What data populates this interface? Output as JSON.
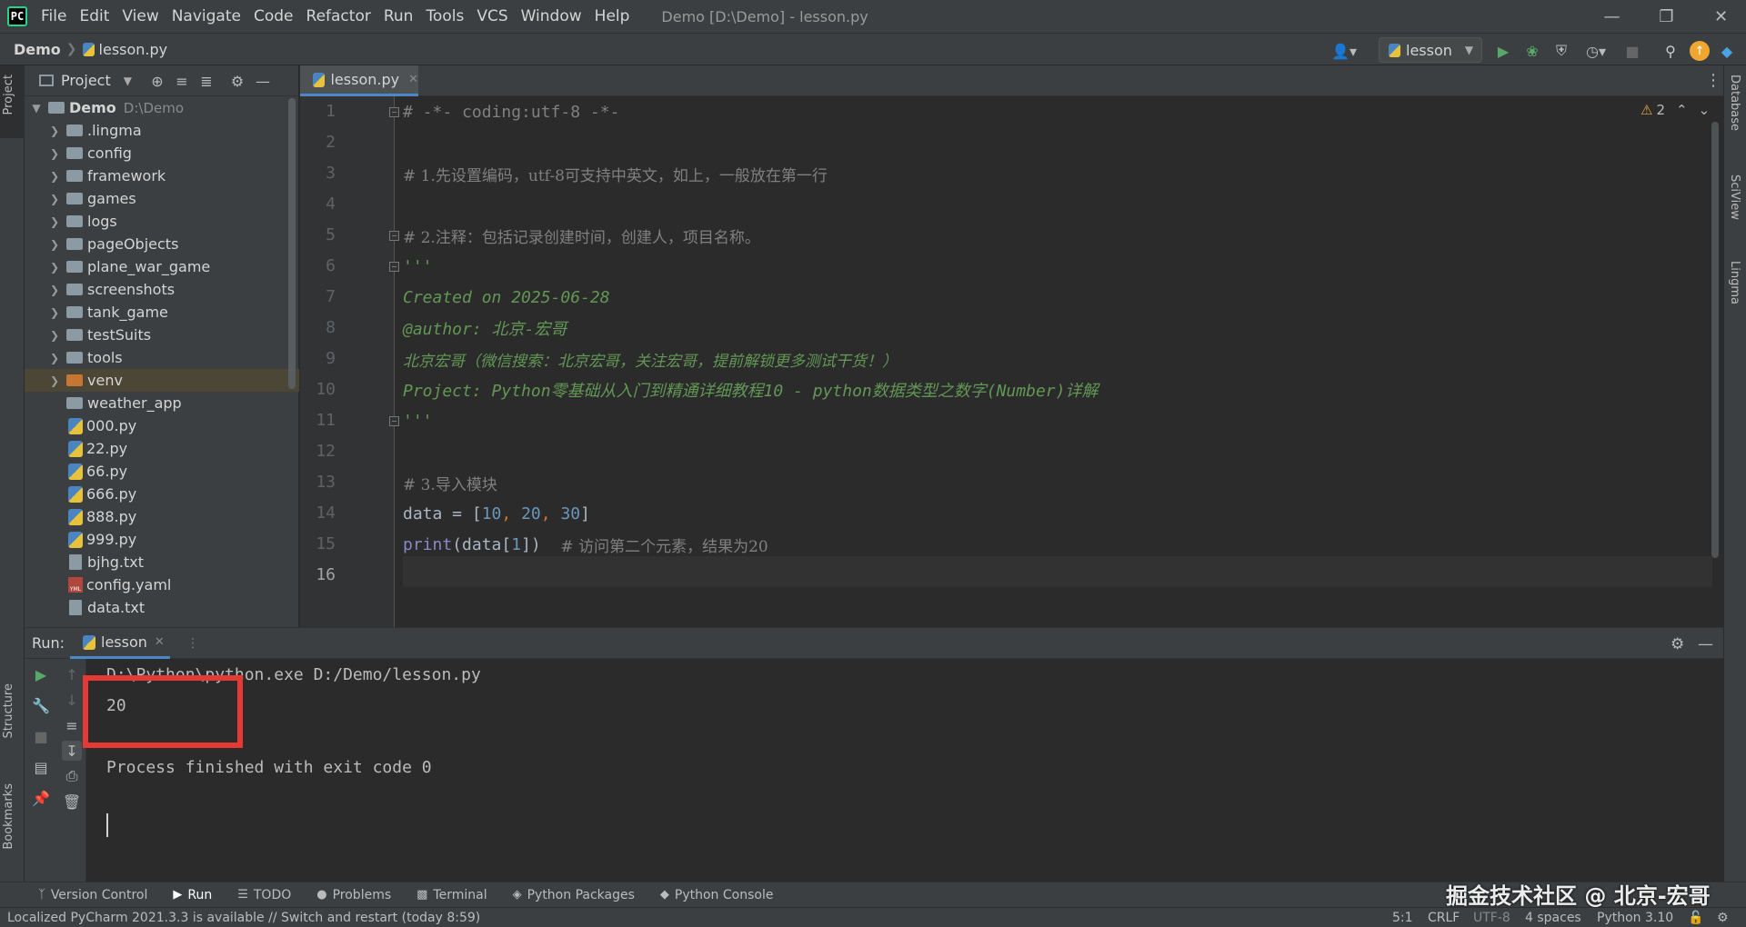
{
  "menu": [
    "File",
    "Edit",
    "View",
    "Navigate",
    "Code",
    "Refactor",
    "Run",
    "Tools",
    "VCS",
    "Window",
    "Help"
  ],
  "window_title": "Demo [D:\\Demo] - lesson.py",
  "app_logo": "PC",
  "breadcrumb": {
    "project": "Demo",
    "file": "lesson.py"
  },
  "run_config": {
    "label": "lesson"
  },
  "left_strip": {
    "project": "Project",
    "structure": "Structure",
    "bookmarks": "Bookmarks"
  },
  "right_strip": {
    "database": "Database",
    "sciview": "SciView",
    "lingma": "Lingma"
  },
  "project_panel": {
    "title": "Project",
    "root": {
      "name": "Demo",
      "path": "D:\\Demo"
    },
    "folders": [
      ".lingma",
      "config",
      "framework",
      "games",
      "logs",
      "pageObjects",
      "plane_war_game",
      "screenshots",
      "tank_game",
      "testSuits",
      "tools",
      "venv",
      "weather_app"
    ],
    "files": [
      "000.py",
      "22.py",
      "66.py",
      "666.py",
      "888.py",
      "999.py",
      "bjhg.txt",
      "config.yaml",
      "data.txt"
    ]
  },
  "editor": {
    "tab": "lesson.py",
    "inspection": {
      "warnings": "2"
    },
    "line_numbers": [
      "1",
      "2",
      "3",
      "4",
      "5",
      "6",
      "7",
      "8",
      "9",
      "10",
      "11",
      "12",
      "13",
      "14",
      "15",
      "16"
    ],
    "code": {
      "l1": "# -*- coding:utf-8 -*-",
      "l3": "# 1.先设置编码，utf-8可支持中英文，如上，一般放在第一行",
      "l5": "# 2.注释：包括记录创建时间，创建人，项目名称。",
      "l6": "'''",
      "l7": "Created on 2025-06-28",
      "l8": "@author: 北京-宏哥",
      "l9": "北京宏哥（微信搜索：北京宏哥，关注宏哥，提前解锁更多测试干货！）",
      "l10": "Project: Python零基础从入门到精通详细教程10 - python数据类型之数字(Number)详解",
      "l11": "'''",
      "l13": "# 3.导入模块",
      "l14": {
        "a": "data = [",
        "n1": "10",
        "c1": ", ",
        "n2": "20",
        "c2": ", ",
        "n3": "30",
        "b": "]"
      },
      "l15": {
        "fn": "print",
        "a": "(data[",
        "n": "1",
        "b": "])  ",
        "comment": "# 访问第二个元素，结果为20"
      }
    }
  },
  "run_panel": {
    "label": "Run:",
    "tab": "lesson",
    "console": [
      "D:\\Python\\python.exe D:/Demo/lesson.py",
      "20",
      "",
      "Process finished with exit code 0"
    ]
  },
  "tool_windows": [
    "Version Control",
    "Run",
    "TODO",
    "Problems",
    "Terminal",
    "Python Packages",
    "Python Console"
  ],
  "watermark": "掘金技术社区 @ 北京-宏哥",
  "status_bar": {
    "message": "Localized PyCharm 2021.3.3 is available // Switch and restart (today 8:59)",
    "position": "5:1",
    "line_sep": "CRLF",
    "encoding": "UTF-8",
    "indent": "4 spaces",
    "interpreter": "Python 3.10"
  },
  "colors": {
    "accent": "#4a88c7",
    "highlight_box": "#e53935",
    "run_green": "#59a869"
  }
}
